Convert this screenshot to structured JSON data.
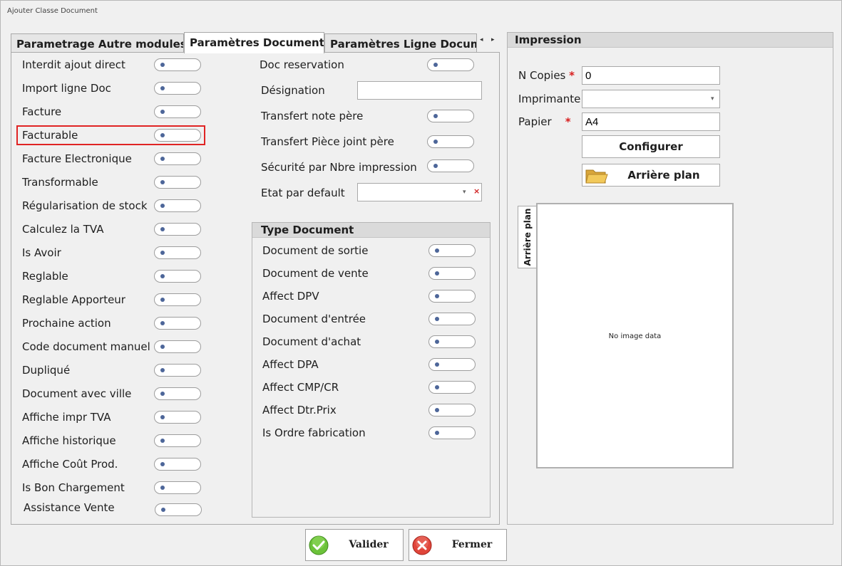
{
  "window": {
    "title": "Ajouter Classe Document"
  },
  "tabs": [
    {
      "label": "Parametrage Autre modules",
      "active": false
    },
    {
      "label": "Paramètres Document",
      "active": true
    },
    {
      "label": "Paramètres Ligne Document",
      "active": false
    }
  ],
  "tab_nav": {
    "prev": "◂",
    "next": "▸"
  },
  "left_options": [
    {
      "label": "Interdit ajout direct",
      "value": false
    },
    {
      "label": "Import ligne Doc",
      "value": false
    },
    {
      "label": "Facture",
      "value": false
    },
    {
      "label": "Facturable",
      "value": false,
      "highlighted": true
    },
    {
      "label": "Facture Electronique",
      "value": false
    },
    {
      "label": "Transformable",
      "value": false
    },
    {
      "label": "Régularisation de stock",
      "value": false
    },
    {
      "label": "Calculez la TVA",
      "value": false
    },
    {
      "label": "Is Avoir",
      "value": false
    },
    {
      "label": "Reglable",
      "value": false
    },
    {
      "label": "Reglable Apporteur",
      "value": false
    },
    {
      "label": "Prochaine action",
      "value": false
    },
    {
      "label": "Code document manuel",
      "value": false
    },
    {
      "label": "Dupliqué",
      "value": false
    },
    {
      "label": "Document avec ville",
      "value": false
    },
    {
      "label": "Affiche impr TVA",
      "value": false
    },
    {
      "label": "Affiche historique",
      "value": false
    },
    {
      "label": "Affiche Coût Prod.",
      "value": false
    },
    {
      "label": "Is Bon Chargement",
      "value": false
    },
    {
      "label": "Assistance Vente",
      "value": false
    }
  ],
  "middle": {
    "doc_reservation": "Doc reservation",
    "designation_label": "Désignation",
    "designation_value": "",
    "transfert_note": "Transfert note père",
    "transfert_piece": "Transfert Pièce joint père",
    "securite": "Sécurité par Nbre impression",
    "etat_label": "Etat par default",
    "etat_value": "",
    "combo_arrow": "▾",
    "combo_clear": "×"
  },
  "type_document": {
    "title": "Type Document",
    "options": [
      {
        "label": "Document de sortie",
        "value": false
      },
      {
        "label": "Document de vente",
        "value": false
      },
      {
        "label": "Affect DPV",
        "value": false
      },
      {
        "label": "Document d'entrée",
        "value": false
      },
      {
        "label": "Document d'achat",
        "value": false
      },
      {
        "label": "Affect DPA",
        "value": false
      },
      {
        "label": "Affect CMP/CR",
        "value": false
      },
      {
        "label": "Affect Dtr.Prix",
        "value": false
      },
      {
        "label": "Is Ordre fabrication",
        "value": false
      }
    ]
  },
  "impression": {
    "title": "Impression",
    "copies_label": "N Copies",
    "copies_value": "0",
    "imprimante_label": "Imprimante",
    "imprimante_value": "",
    "papier_label": "Papier",
    "papier_value": "A4",
    "required_mark": "*",
    "configurer": "Configurer",
    "arriere_plan_button": "Arrière plan",
    "side_tab": "Arrière plan",
    "no_image": "No image data"
  },
  "footer": {
    "valider": "Valider",
    "fermer": "Fermer"
  },
  "colors": {
    "highlight": "#e02424",
    "toggle_dot": "#4d6699",
    "required": "#d81e1e",
    "ok_green": "#5cb82e",
    "cancel_red": "#d9322b"
  }
}
